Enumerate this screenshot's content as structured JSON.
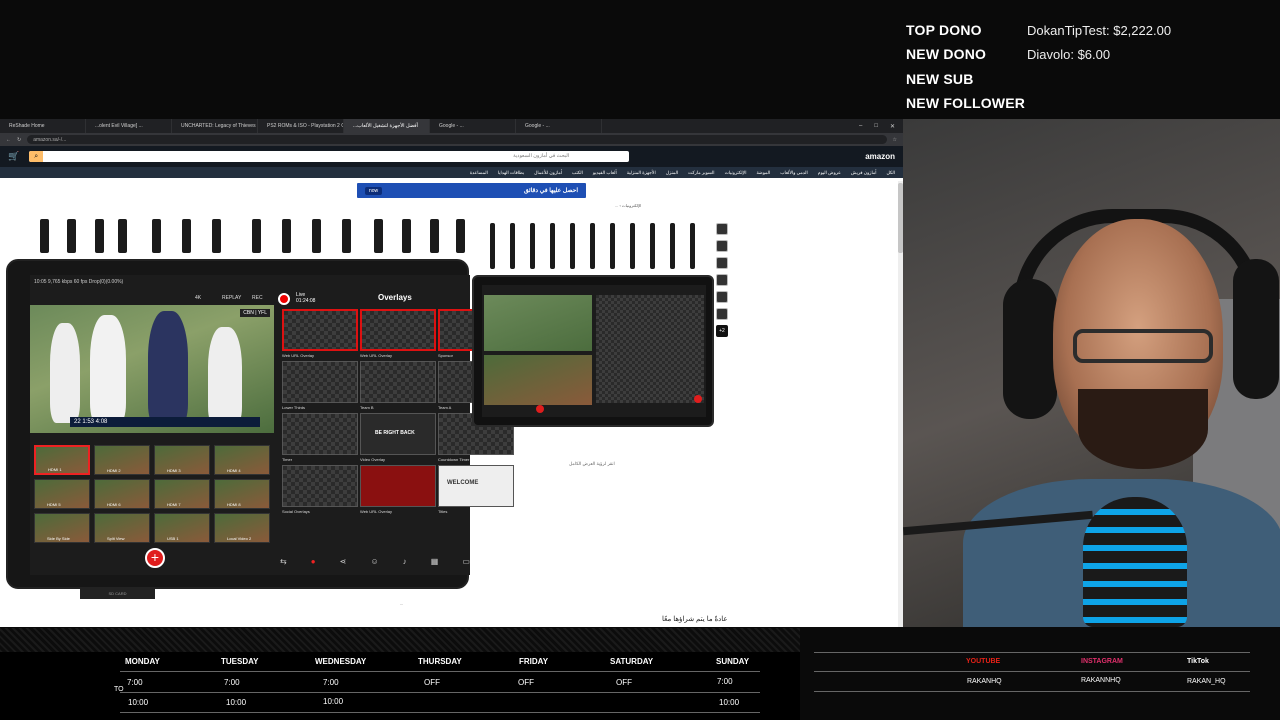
{
  "alerts": {
    "top_dono": {
      "label": "TOP DONO",
      "value": "DokanTipTest: $2,222.00"
    },
    "new_dono": {
      "label": "NEW DONO",
      "value": "Diavolo: $6.00"
    },
    "new_sub": {
      "label": "NEW SUB",
      "value": ""
    },
    "new_follower": {
      "label": "NEW FOLLOWER",
      "value": ""
    }
  },
  "browser": {
    "tabs": [
      "ReShade Home",
      "...olent Evil Village] ...",
      "UNCHARTED: Legacy of Thieves Col...",
      "PS2 ROMs & ISO - Playstation 2 Ga...",
      "...أفضل الأجهزة لتشغيل الألعاب",
      "Google - ...",
      "Google - ..."
    ],
    "url": "amazon.sa/-/...",
    "search_placeholder": "البحث في أمازون السعودية",
    "nav_items": [
      "الكل",
      "أمازون فريش",
      "عروض اليوم",
      "الدمى والألعاب",
      "الموضة",
      "الإلكترونيات",
      "السوبر ماركت",
      "المنزل",
      "الأجهزة المنزلية",
      "ألعاب الفيديو",
      "الكتب",
      "أمازون للأعمال",
      "بطاقات الهدايا",
      "المساعدة"
    ],
    "banner_text": "احصل عليها في دقائق",
    "banner_badge": "now",
    "breadcrumb": "الإلكترونيات › ...",
    "zoom_note": "انقر لرؤية العرض الكامل",
    "bottom_caption": "عادةً ما يتم شراؤها معًا",
    "page_note": "...",
    "sd_card": "SD CARD"
  },
  "tablet": {
    "status": "10:05  9,765 kbps  60 fps  Drop(0)(0.00%)",
    "live_label": "Live",
    "live_time": "01:24:08",
    "overlays_title": "Overlays",
    "replay": "REPLAY",
    "rec": "REC",
    "resolution": "4K",
    "cbn": "CBN | YFL",
    "score": "22  1:53  4:08",
    "overlay_labels": [
      "Web URL Overlay",
      "Web URL Overlay",
      "Sponsor",
      "Lower Thirds",
      "Team B",
      "Team A",
      "Timer",
      "Video Overlay",
      "Countdown Timer",
      "Social Overlays",
      "Web URL Overlay",
      "Titles"
    ],
    "be_right_back": "BE RIGHT BACK",
    "welcome": "WELCOME",
    "cam_labels": [
      "HDMI 1",
      "HDMI 2",
      "HDMI 3",
      "HDMI 4",
      "HDMI 5",
      "HDMI 6",
      "HDMI 7",
      "HDMI 8",
      "Side By Side",
      "Split View",
      "USB 1",
      "Local Video 2"
    ]
  },
  "schedule": {
    "days": [
      "MONDAY",
      "TUESDAY",
      "WEDNESDAY",
      "THURSDAY",
      "FRIDAY",
      "SATURDAY",
      "SUNDAY"
    ],
    "start": [
      "7:00",
      "7:00",
      "7:00",
      "OFF",
      "OFF",
      "OFF",
      "7:00"
    ],
    "end": [
      "10:00",
      "10:00",
      "10:00",
      "",
      "",
      "",
      "10:00"
    ],
    "to_label": "TO"
  },
  "socials": {
    "platforms": [
      {
        "name": "YOUTUBE",
        "handle": "RAKANHQ",
        "color": "#e62117"
      },
      {
        "name": "INSTAGRAM",
        "handle": "RAKANNHQ",
        "color": "#e1306c"
      },
      {
        "name": "TikTok",
        "handle": "RAKAN_HQ",
        "color": "#ffffff"
      }
    ]
  },
  "colors": {
    "accent_red": "#e01d1d",
    "amazon_dark": "#131921",
    "amazon_nav": "#232f3e",
    "search_button": "#febd69"
  }
}
